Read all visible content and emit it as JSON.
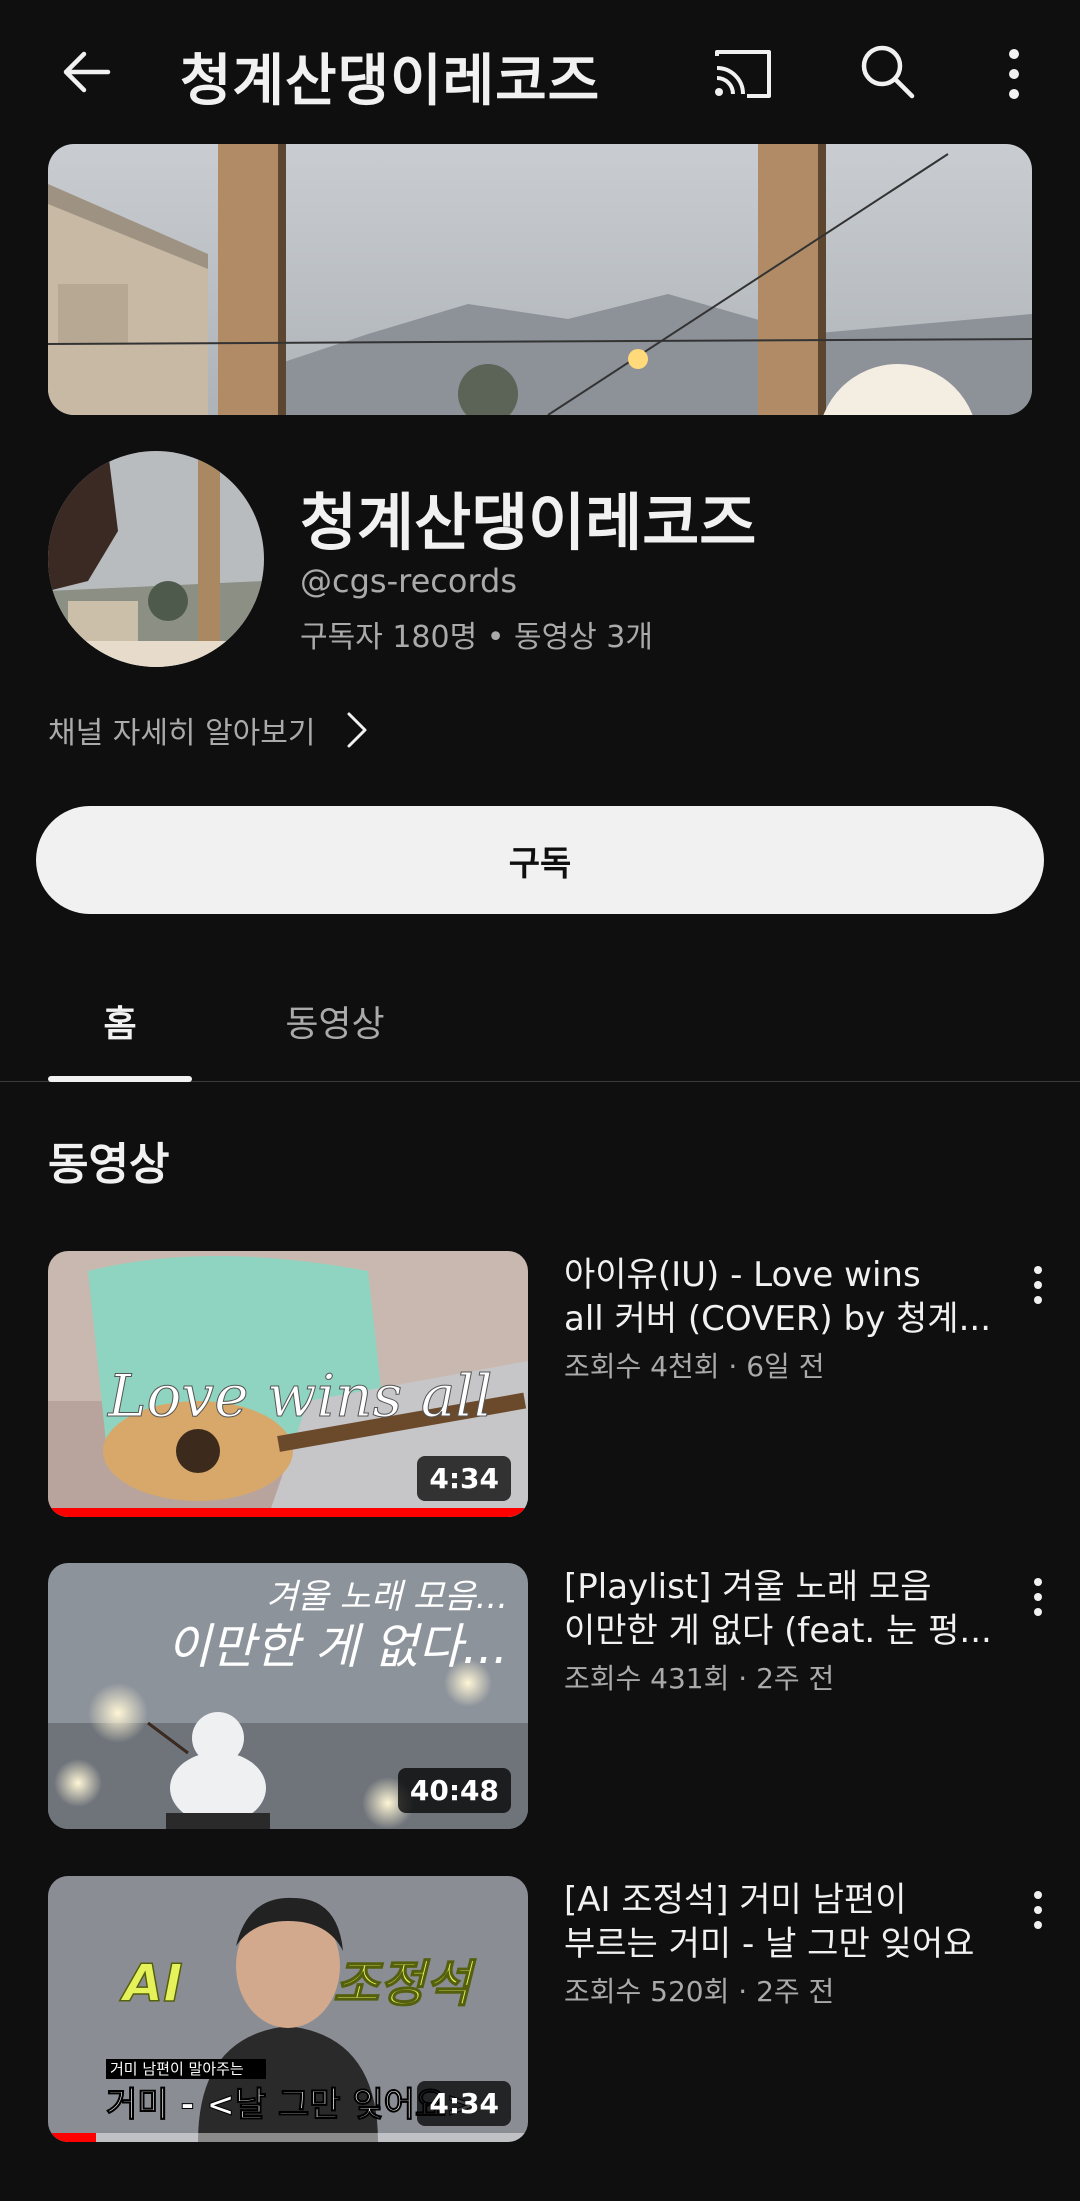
{
  "header": {
    "title": "청계산댕이레코즈",
    "back_icon": "arrow-left-icon",
    "cast_icon": "cast-icon",
    "search_icon": "search-icon",
    "more_icon": "more-vertical-icon"
  },
  "channel": {
    "name": "청계산댕이레코즈",
    "handle": "@cgs-records",
    "stats": "구독자 180명 • 동영상 3개",
    "more_link": "채널 자세히 알아보기",
    "subscribe_label": "구독"
  },
  "tabs": [
    {
      "label": "홈",
      "selected": true
    },
    {
      "label": "동영상",
      "selected": false
    }
  ],
  "section": {
    "title": "동영상"
  },
  "videos": [
    {
      "title_line1": "아이유(IU) - Love wins",
      "title_line2": "all 커버 (COVER) by 청계...",
      "meta": "조회수 4천회 · 6일 전",
      "duration": "4:34",
      "thumb_text": "Love wins all",
      "progress": 1.0
    },
    {
      "title_line1": "[Playlist] 겨울 노래 모음",
      "title_line2": "이만한 게 없다 (feat. 눈 펑...",
      "meta": "조회수 431회 · 2주 전",
      "duration": "40:48",
      "thumb_text_small": "겨울 노래 모음...",
      "thumb_text_big": "이만한 게 없다...",
      "progress": 0
    },
    {
      "title_line1": "[AI 조정석] 거미 남편이",
      "title_line2": "부르는 거미 - 날 그만 잊어요",
      "meta": "조회수 520회 · 2주 전",
      "duration": "4:34",
      "thumb_text_ai": "AI",
      "thumb_text_name": "조정석",
      "thumb_text_caption_small": "거미 남편이 말아주는",
      "thumb_text_caption": "거미 - <날 그만 잊어요>",
      "progress": 0.1
    }
  ],
  "colors": {
    "background": "#0f0f0f",
    "text": "#f1f1f1",
    "secondary_text": "#aaaaaa",
    "progress": "#ff0000"
  }
}
